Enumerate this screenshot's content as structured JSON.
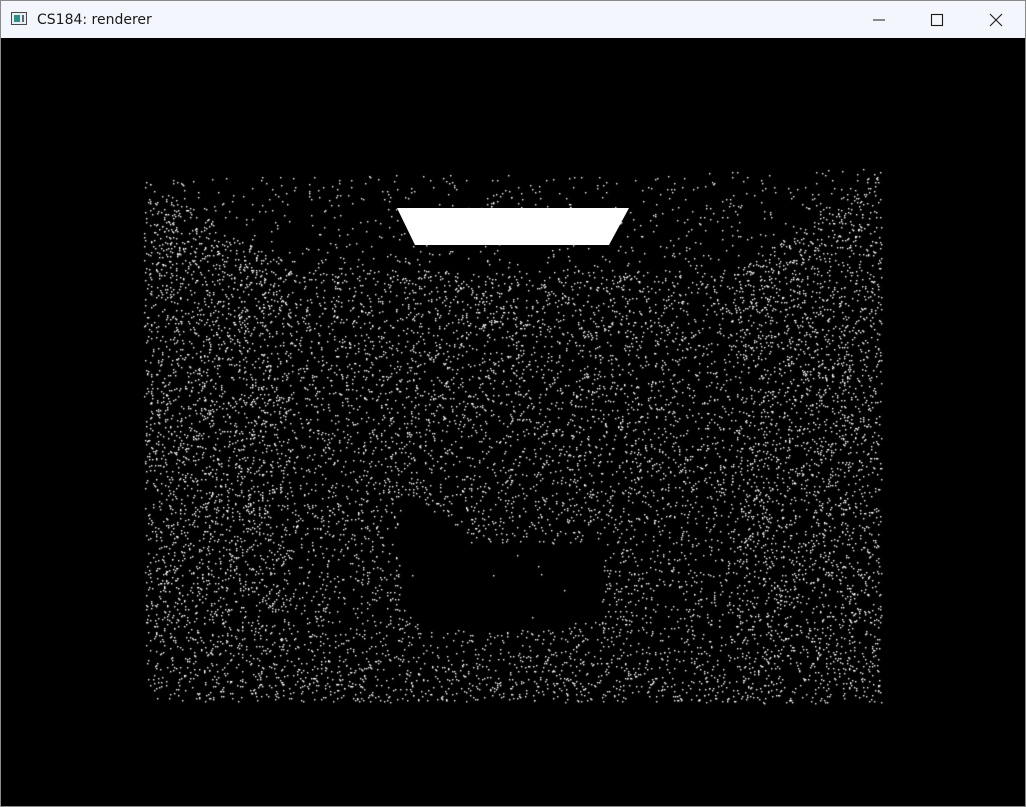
{
  "window": {
    "title": "CS184: renderer",
    "icon": "app-window-icon",
    "controls": {
      "minimize_icon": "minimize-icon",
      "maximize_icon": "maximize-icon",
      "close_icon": "close-icon"
    }
  },
  "render": {
    "background_color": "#000000",
    "sample_color": "#ffffff",
    "area_light_color": "#ffffff",
    "scene_objects": [
      "area-light",
      "back-wall",
      "left-wall",
      "right-wall",
      "floor",
      "ceiling",
      "occluding-object"
    ]
  }
}
